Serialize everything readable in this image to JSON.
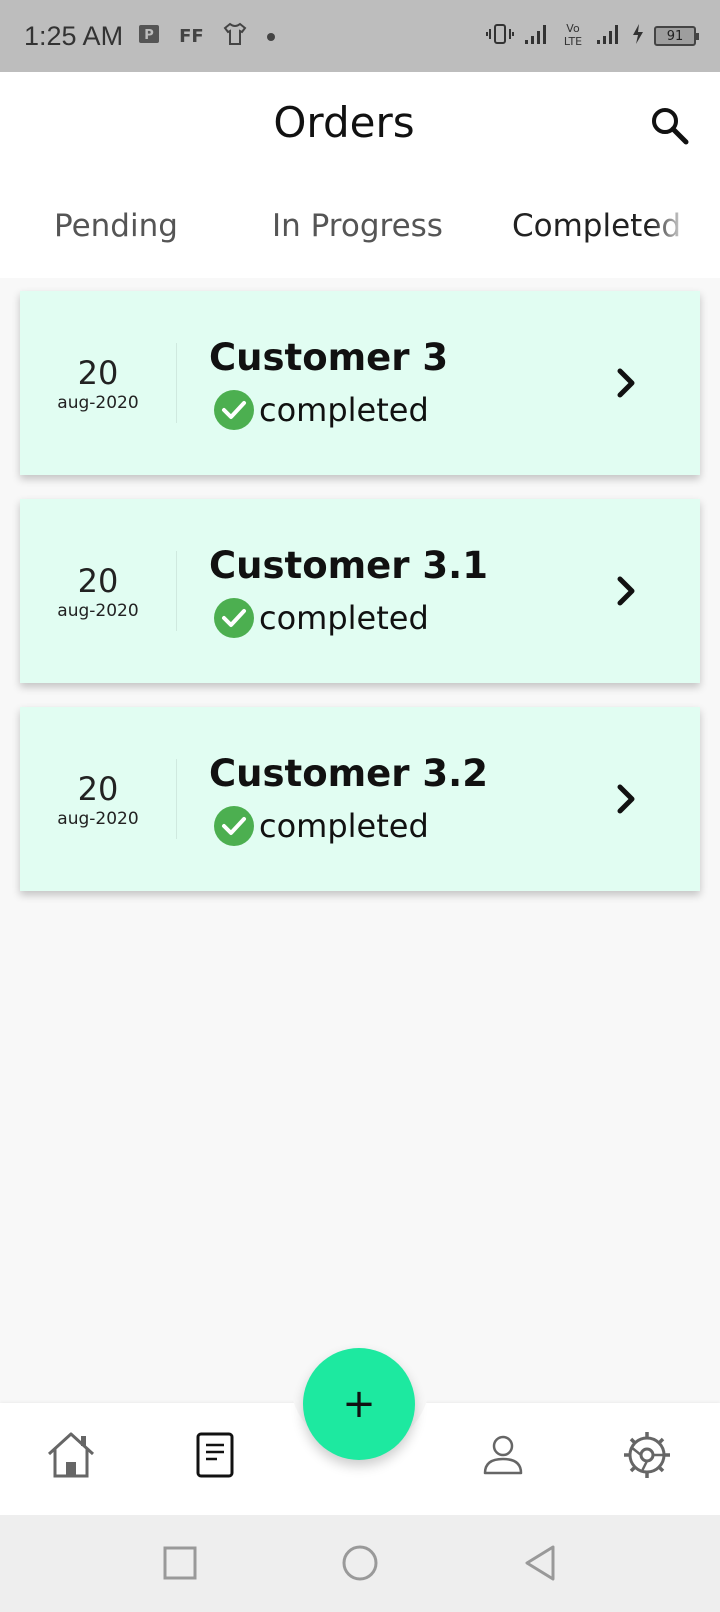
{
  "status_bar": {
    "time": "1:25 AM",
    "left_icons": [
      "P",
      "FF",
      "shirt-icon",
      "dot-icon"
    ],
    "battery": "91"
  },
  "header": {
    "title": "Orders"
  },
  "tabs": [
    {
      "label": "Pending"
    },
    {
      "label": "In Progress"
    },
    {
      "label": "Completed"
    }
  ],
  "orders": [
    {
      "day": "20",
      "month": "aug-2020",
      "customer": "Customer 3",
      "status": "completed"
    },
    {
      "day": "20",
      "month": "aug-2020",
      "customer": "Customer 3.1",
      "status": "completed"
    },
    {
      "day": "20",
      "month": "aug-2020",
      "customer": "Customer 3.2",
      "status": "completed"
    }
  ],
  "fab": {
    "label": "+"
  },
  "colors": {
    "accent": "#1de9a0",
    "card_bg": "#e1fdf2",
    "status_ok": "#4caf50"
  }
}
